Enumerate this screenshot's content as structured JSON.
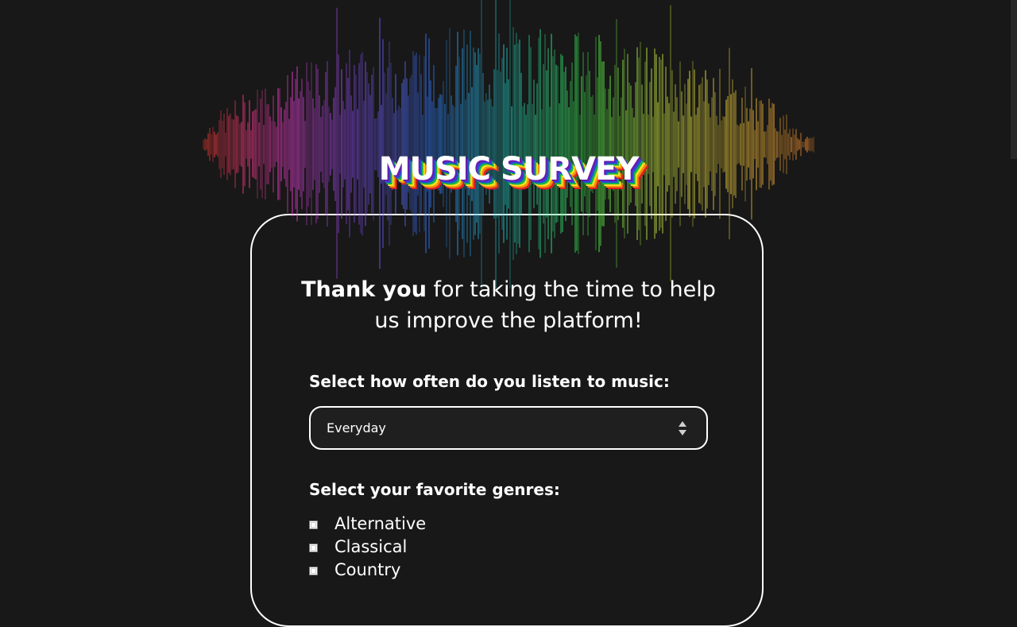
{
  "header": {
    "title": "MUSIC SURVEY"
  },
  "intro": {
    "bold": "Thank you",
    "text_line1": " for taking the time to help",
    "text_line2": "us improve the platform!"
  },
  "frequency": {
    "label": "Select how often do you listen to music:",
    "selected": "Everyday"
  },
  "genres": {
    "label": "Select your favorite genres:",
    "items": [
      {
        "label": "Alternative",
        "checked": false
      },
      {
        "label": "Classical",
        "checked": false
      },
      {
        "label": "Country",
        "checked": false
      }
    ]
  },
  "colors": {
    "background": "#181818",
    "text": "#ffffff",
    "rainbow": [
      "#ff3a2a",
      "#ff3ccf",
      "#8a4dff",
      "#2f7bff",
      "#1fd6c8",
      "#39f04a",
      "#d6f23c",
      "#ffd23a",
      "#ff8a2a"
    ]
  }
}
